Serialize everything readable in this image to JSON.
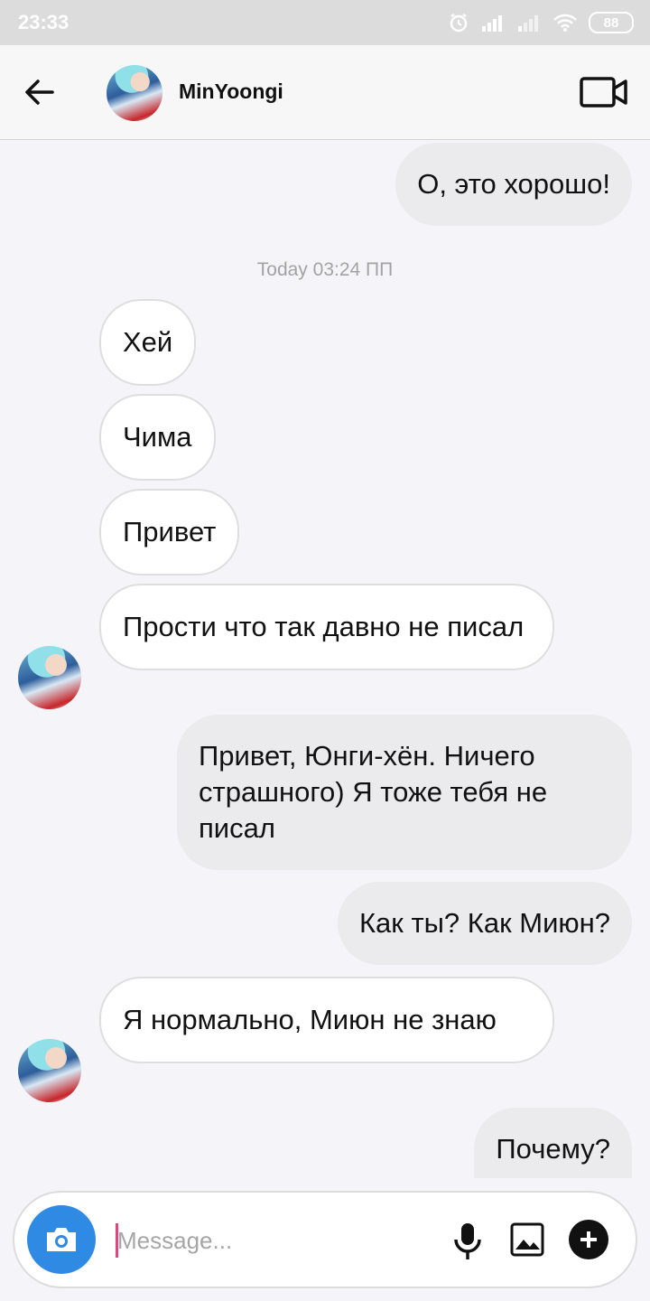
{
  "status_bar": {
    "time": "23:33",
    "battery": "88"
  },
  "header": {
    "contact_name": "MinYoongi"
  },
  "chat": {
    "timestamp": "Today 03:24 ПП",
    "messages": [
      {
        "dir": "sent",
        "text": "О, это хорошо!"
      },
      {
        "dir": "received",
        "text": "Хей"
      },
      {
        "dir": "received",
        "text": "Чима"
      },
      {
        "dir": "received",
        "text": "Привет"
      },
      {
        "dir": "received",
        "text": "Прости что так давно не писал"
      },
      {
        "dir": "sent",
        "text": "Привет, Юнги-хён. Ничего страшного) Я тоже тебя не писал"
      },
      {
        "dir": "sent",
        "text": "Как ты? Как Миюн?"
      },
      {
        "dir": "received",
        "text": "Я нормально, Миюн не знаю"
      },
      {
        "dir": "sent",
        "text": "Почему?"
      }
    ]
  },
  "composer": {
    "placeholder": "Message...",
    "value": ""
  }
}
